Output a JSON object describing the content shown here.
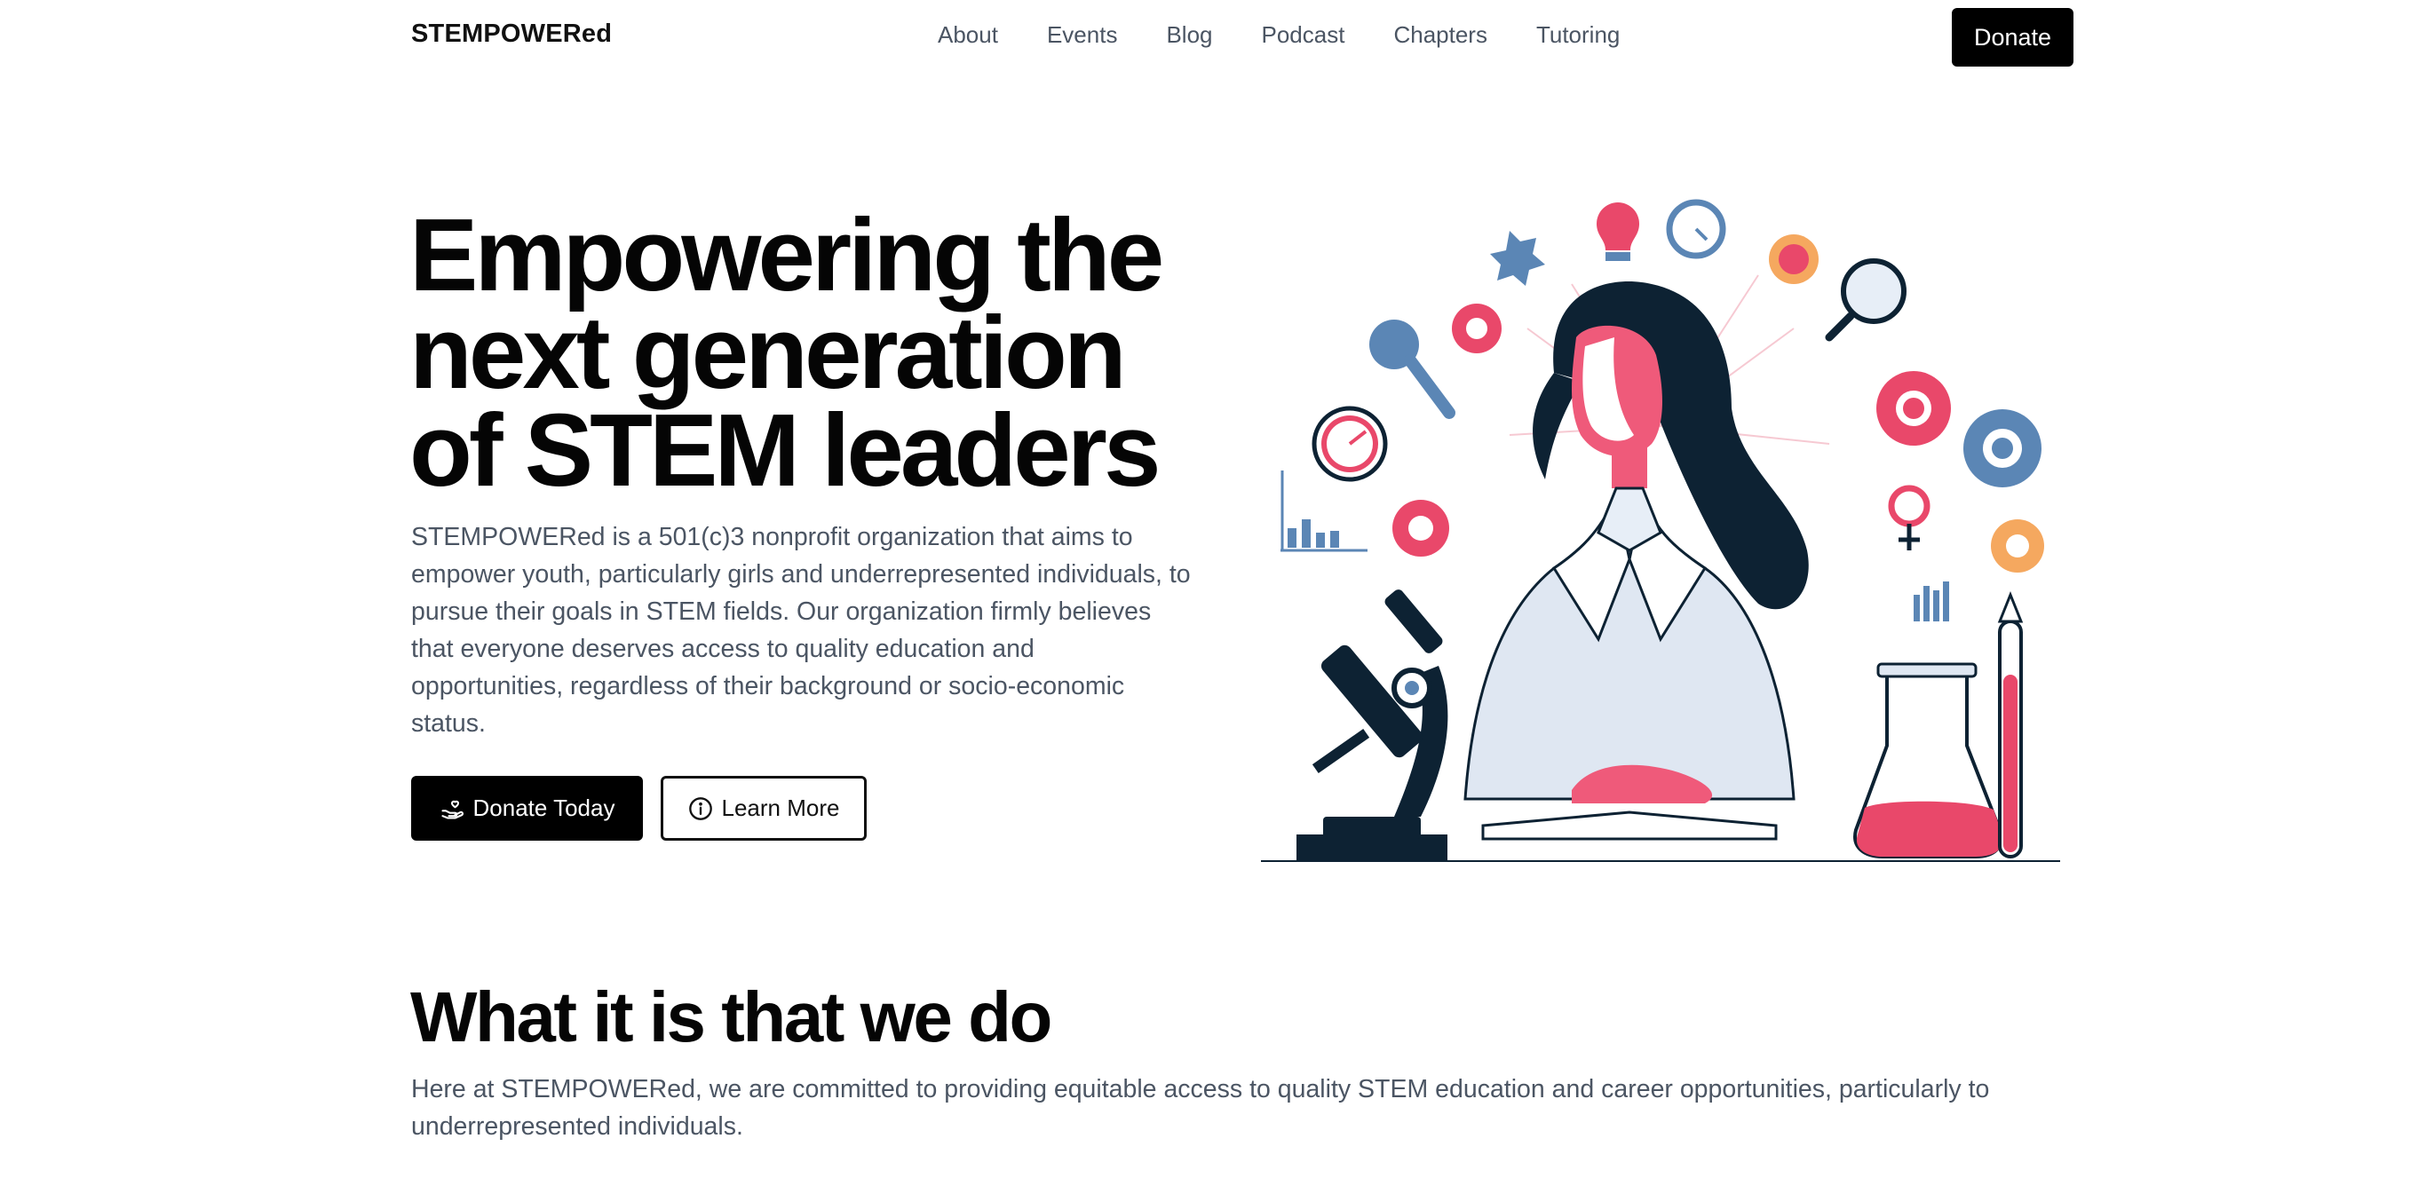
{
  "nav": {
    "brand": "STEMPOWERed",
    "links": [
      "About",
      "Events",
      "Blog",
      "Podcast",
      "Chapters",
      "Tutoring"
    ],
    "donate_label": "Donate"
  },
  "hero": {
    "title": "Empowering the next generation of STEM leaders",
    "description": "STEMPOWERed is a 501(c)3 nonprofit organization that aims to empower youth, particularly girls and underrepresented individuals, to pursue their goals in STEM fields. Our organization firmly believes that everyone deserves access to quality education and opportunities, regardless of their background or socio-economic status.",
    "primary_button": "Donate Today",
    "primary_icon": "hand-heart-icon",
    "secondary_button": "Learn More",
    "secondary_icon": "info-circle-icon"
  },
  "section": {
    "title": "What it is that we do",
    "description": "Here at STEMPOWERed, we are committed to providing equitable access to quality STEM education and career opportunities, particularly to underrepresented individuals."
  },
  "colors": {
    "accent_pink": "#ea4c6c",
    "navy": "#0d2233",
    "steel_blue": "#5b86b5",
    "text_gray": "#4b5563"
  }
}
